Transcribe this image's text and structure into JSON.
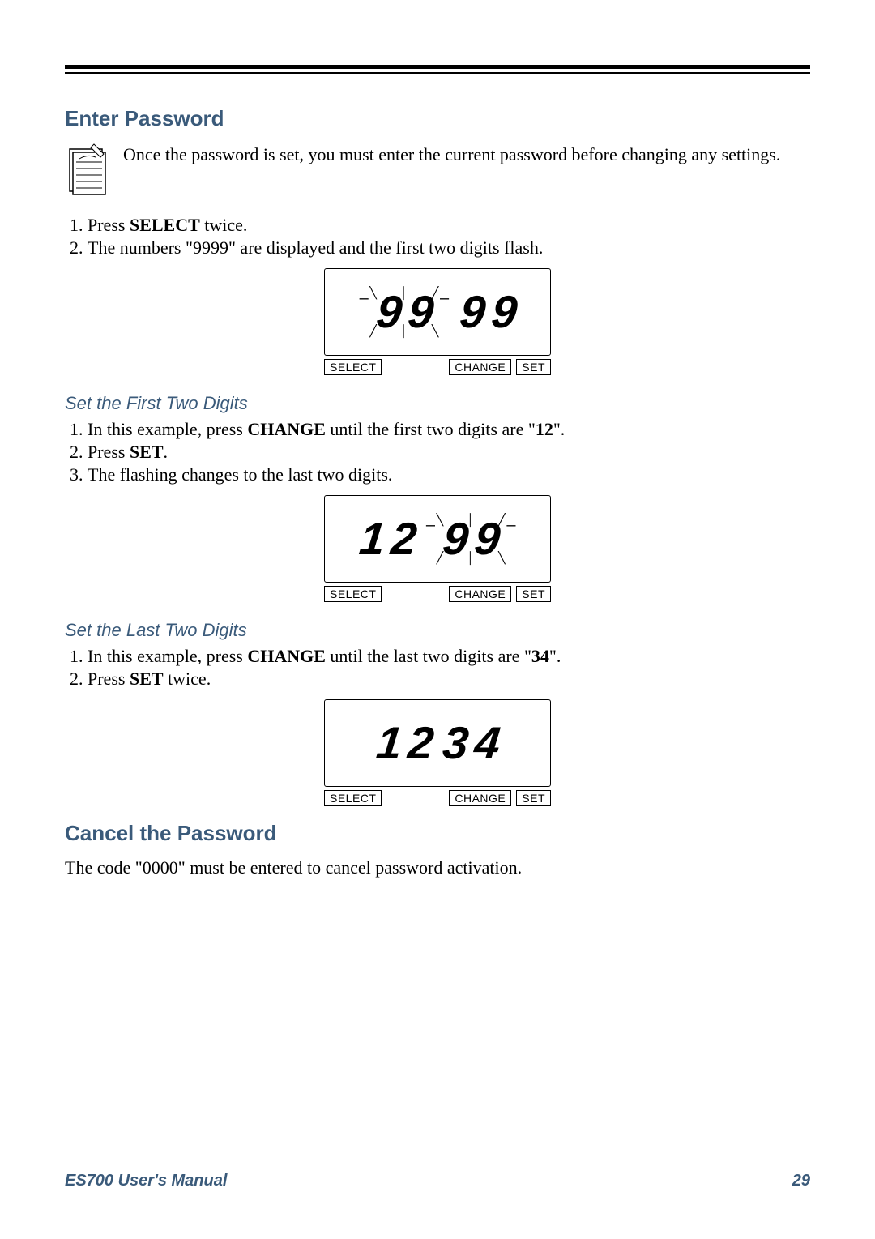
{
  "sections": {
    "enter_password": {
      "heading": "Enter Password",
      "note": "Once the password is set, you must enter the current password before changing any settings.",
      "steps": {
        "s1a": "Press ",
        "s1b": "SELECT",
        "s1c": " twice.",
        "s2": "The numbers \"9999\" are displayed and the first two digits flash."
      }
    },
    "first_two": {
      "heading": "Set the First Two Digits",
      "steps": {
        "s1a": "In this example, press ",
        "s1b": "CHANGE",
        "s1c": " until the first two digits are \"",
        "s1d": "12",
        "s1e": "\".",
        "s2a": "Press ",
        "s2b": "SET",
        "s2c": ".",
        "s3": "The flashing changes to the last two digits."
      }
    },
    "last_two": {
      "heading": "Set the Last Two Digits",
      "steps": {
        "s1a": "In this example, press ",
        "s1b": "CHANGE",
        "s1c": " until the last two digits are \"",
        "s1d": "34",
        "s1e": "\".",
        "s2a": "Press ",
        "s2b": "SET",
        "s2c": " twice."
      }
    },
    "cancel": {
      "heading": "Cancel the Password",
      "text": "The code \"0000\" must be entered to cancel  password activation."
    }
  },
  "displays": {
    "d1": {
      "left1": "9",
      "left2": "9",
      "right1": "9",
      "right2": "9",
      "flash": "left"
    },
    "d2": {
      "left1": "1",
      "left2": "2",
      "right1": "9",
      "right2": "9",
      "flash": "right"
    },
    "d3": {
      "left1": "1",
      "left2": "2",
      "right1": "3",
      "right2": "4",
      "flash": "none"
    }
  },
  "buttons": {
    "select": "SELECT",
    "change": "CHANGE",
    "set": "SET"
  },
  "footer": {
    "title": "ES700 User's Manual",
    "page": "29"
  }
}
